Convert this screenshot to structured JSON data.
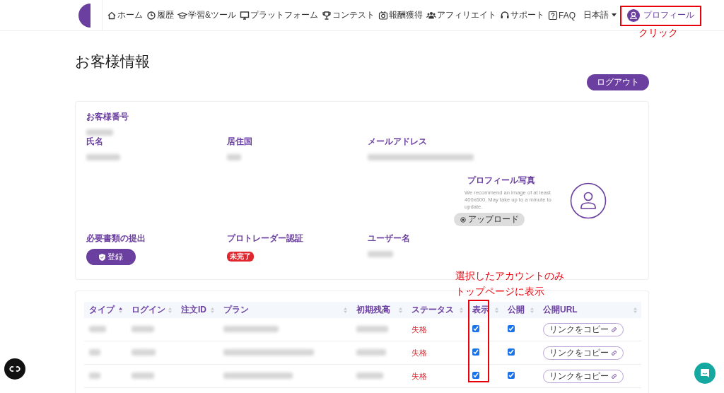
{
  "nav": {
    "items": [
      {
        "label": "ホーム"
      },
      {
        "label": "履歴"
      },
      {
        "label": "学習&ツール"
      },
      {
        "label": "プラットフォーム"
      },
      {
        "label": "コンテスト"
      },
      {
        "label": "報酬獲得"
      },
      {
        "label": "アフィリエイト"
      },
      {
        "label": "サポート"
      },
      {
        "label": "FAQ"
      }
    ],
    "language": "日本語",
    "profile": "プロフィール"
  },
  "page_title": "お客様情報",
  "logout": "ログアウト",
  "info": {
    "top_fields": [
      {
        "label": "お客様番号",
        "kind": "blurred"
      }
    ],
    "fields": [
      {
        "label": "氏名",
        "kind": "blurred"
      },
      {
        "label": "居住国",
        "kind": "blurred"
      },
      {
        "label": "メールアドレス",
        "kind": "blurred"
      }
    ],
    "photo": {
      "title": "プロフィール写真",
      "hint": "We recommend an image of at least 400x600. May take up to a minute to update.",
      "upload": "アップロード"
    },
    "bottom_fields": [
      {
        "label": "必要書類の提出",
        "kind": "button",
        "value": "登録"
      },
      {
        "label": "プロトレーダー認証",
        "kind": "badge",
        "value": "未完了"
      },
      {
        "label": "ユーザー名",
        "kind": "blurred"
      }
    ]
  },
  "table": {
    "columns": [
      {
        "label": "タイプ",
        "sorted": true
      },
      {
        "label": "ログイン",
        "sorted": false
      },
      {
        "label": "注文ID",
        "sorted": false
      },
      {
        "label": "プラン",
        "sorted": false
      },
      {
        "label": "初期残高",
        "sorted": false
      },
      {
        "label": "ステータス",
        "sorted": false
      },
      {
        "label": "表示",
        "sorted": false
      },
      {
        "label": "公開",
        "sorted": false
      },
      {
        "label": "公開URL",
        "sorted": false
      }
    ],
    "rows": [
      {
        "status": "失格",
        "show": true,
        "public": true,
        "copy": "リンクをコピー"
      },
      {
        "status": "失格",
        "show": true,
        "public": true,
        "copy": "リンクをコピー"
      },
      {
        "status": "失格",
        "show": true,
        "public": true,
        "copy": "リンクをコピー"
      }
    ]
  },
  "annotations": [
    {
      "kind": "profile",
      "lines": [
        "クリック"
      ]
    },
    {
      "kind": "show-column",
      "lines": [
        "選択したアカウントのみ",
        "トップページに表示"
      ]
    }
  ]
}
